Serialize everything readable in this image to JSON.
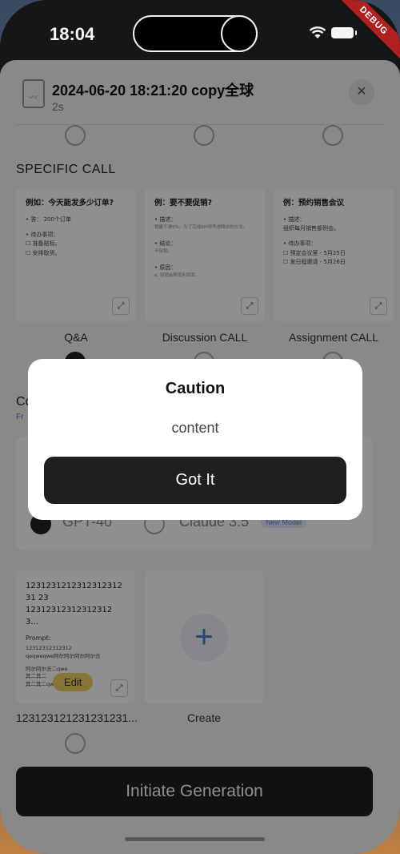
{
  "status_bar": {
    "time": "18:04",
    "debug_label": "DEBUG"
  },
  "header": {
    "title": "2024-06-20 18:21:20 copy全球",
    "subtitle": "2s",
    "close_label": "✕"
  },
  "section": {
    "title": "SPECIFIC CALL"
  },
  "call_cards": [
    {
      "label": "Q&A",
      "heading": "例如：今天能发多少订单?",
      "lines": [
        "• 答：  200个订单",
        "• 待办事项：",
        "☐  准备贴标。",
        "☐  安排取货。"
      ]
    },
    {
      "label": "Discussion CALL",
      "heading": "例：要不要促销?",
      "lines": [
        "• 描述：",
        "销量下滑5%。为了完成KPI得考虑降价的方法。",
        "• 结论：",
        "不促销。",
        "• 原因：",
        "a. 促销会降低利润率。"
      ]
    },
    {
      "label": "Assignment CALL",
      "heading": "例：预约销售会议",
      "lines": [
        "• 描述：",
        "组织每月销售部例会。",
        "• 待办事项：",
        "☐  预定会议室 - 5月25日",
        "☐  发日程邀请 - 5月26日"
      ]
    }
  ],
  "custom": {
    "title": "Co",
    "subtitle": "Fr"
  },
  "models": {
    "selected": "GPT-4o",
    "other": "Claude 3.5",
    "new_badge": "New Model"
  },
  "template_card": {
    "heading": "1231231212312312312312312312312312312312312312312312312...",
    "heading_line1": "123123121231231231231 23",
    "heading_line2": "123123123123123123...",
    "prompt_label": "Prompt:",
    "body_lines": [
      "12312312312312",
      "qeqweqwe阿尔阿尔阿尔阿尔去",
      "",
      "阿尔阿尔去二qwe",
      "其二其二",
      "其二其二qw"
    ],
    "edit_label": "Edit",
    "label": "123123121231231231..."
  },
  "create_card": {
    "label": "Create",
    "plus": "+"
  },
  "generate_button": {
    "label": "Initiate Generation"
  },
  "dialog": {
    "title": "Caution",
    "content": "content",
    "button": "Got It"
  }
}
